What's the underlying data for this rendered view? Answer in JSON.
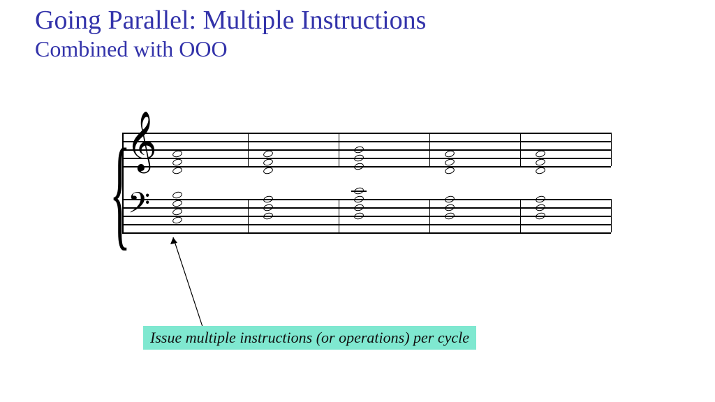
{
  "title": {
    "line1": "Going Parallel: Multiple Instructions",
    "line2": "Combined with OOO"
  },
  "callout": "Issue multiple instructions (or operations) per cycle",
  "music": {
    "measures": 5,
    "staves": [
      {
        "clef": "treble",
        "chords": [
          {
            "measure": 0,
            "notes": [
              -1,
              1,
              3
            ]
          },
          {
            "measure": 1,
            "notes": [
              -1,
              1,
              3
            ]
          },
          {
            "measure": 2,
            "notes": [
              0,
              2,
              4
            ]
          },
          {
            "measure": 3,
            "notes": [
              -1,
              1,
              3
            ]
          },
          {
            "measure": 4,
            "notes": [
              -1,
              1,
              3
            ]
          }
        ]
      },
      {
        "clef": "bass",
        "chords": [
          {
            "measure": 0,
            "notes": [
              3,
              5,
              7,
              9
            ]
          },
          {
            "measure": 1,
            "notes": [
              4,
              6,
              8
            ]
          },
          {
            "measure": 2,
            "notes": [
              4,
              6,
              8,
              10
            ]
          },
          {
            "measure": 3,
            "notes": [
              4,
              6,
              8
            ]
          },
          {
            "measure": 4,
            "notes": [
              4,
              6,
              8
            ]
          }
        ]
      }
    ]
  }
}
